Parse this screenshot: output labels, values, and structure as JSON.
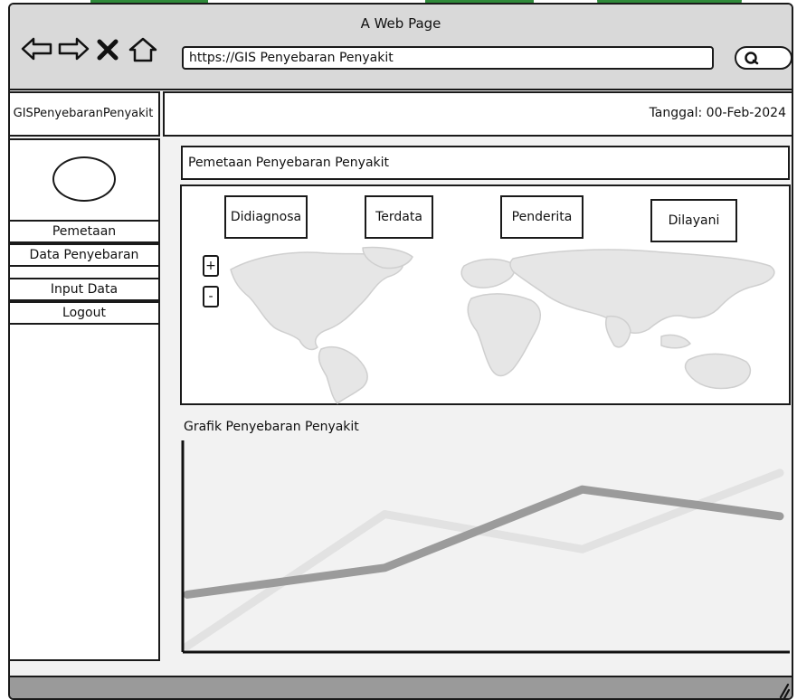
{
  "window": {
    "title": "A Web Page"
  },
  "browser": {
    "url": "https://GIS Penyebaran Penyakit",
    "nav_icons": [
      "back-arrow-icon",
      "forward-arrow-icon",
      "close-icon",
      "home-icon"
    ],
    "search_icon": "search-icon"
  },
  "app": {
    "brand": "GISPenyebaranPenyakit",
    "date_label": "Tanggal: 00-Feb-2024"
  },
  "sidebar": {
    "items": [
      {
        "label": "Pemetaan"
      },
      {
        "label": "Data Penyebaran"
      },
      {
        "label": "Input Data"
      },
      {
        "label": "Logout"
      }
    ]
  },
  "main": {
    "title": "Pemetaan Penyebaran Penyakit",
    "stats": [
      {
        "label": "Didiagnosa"
      },
      {
        "label": "Terdata"
      },
      {
        "label": "Penderita"
      },
      {
        "label": "Dilayani"
      }
    ],
    "zoom_in": "+",
    "zoom_out": "-"
  },
  "chart_title": "Grafik Penyebaran Penyakit",
  "chart_data": {
    "type": "line",
    "x": [
      0,
      1,
      2,
      3
    ],
    "ylim": [
      0,
      100
    ],
    "grid": false,
    "series": [
      {
        "color": "#e2e2e2",
        "values": [
          2,
          66,
          49,
          86
        ]
      },
      {
        "color": "#9b9b9b",
        "values": [
          27,
          40,
          78,
          65
        ]
      }
    ],
    "title": "",
    "xlabel": "",
    "ylabel": ""
  }
}
